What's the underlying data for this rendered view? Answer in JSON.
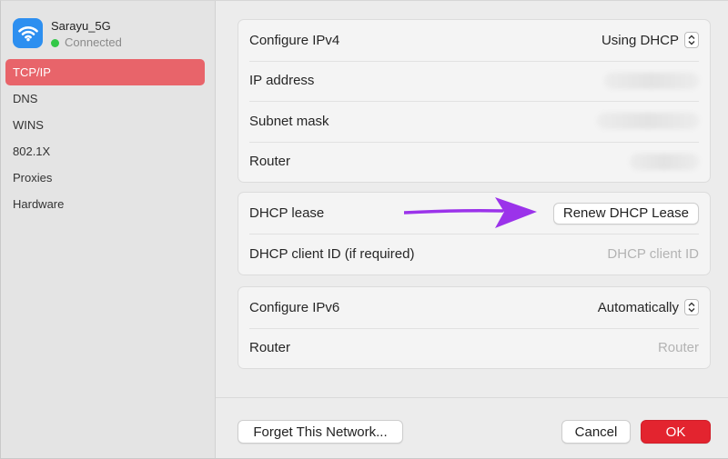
{
  "network": {
    "name": "Sarayu_5G",
    "status": "Connected",
    "icon": "wifi-icon",
    "status_color": "#33c748"
  },
  "sidebar": {
    "items": [
      {
        "label": "TCP/IP",
        "active": true
      },
      {
        "label": "DNS"
      },
      {
        "label": "WINS"
      },
      {
        "label": "802.1X"
      },
      {
        "label": "Proxies"
      },
      {
        "label": "Hardware"
      }
    ],
    "active_color": "#e8646a"
  },
  "ipv4": {
    "configure_label": "Configure IPv4",
    "configure_value": "Using DHCP",
    "ip_label": "IP address",
    "subnet_label": "Subnet mask",
    "router_label": "Router"
  },
  "dhcp": {
    "lease_label": "DHCP lease",
    "renew_button": "Renew DHCP Lease",
    "client_id_label": "DHCP client ID (if required)",
    "client_id_placeholder": "DHCP client ID"
  },
  "ipv6": {
    "configure_label": "Configure IPv6",
    "configure_value": "Automatically",
    "router_label": "Router",
    "router_placeholder": "Router"
  },
  "annotation": {
    "arrow_color": "#9b33ea"
  },
  "footer": {
    "forget_button": "Forget This Network...",
    "cancel_button": "Cancel",
    "ok_button": "OK",
    "ok_color": "#e3242f"
  }
}
